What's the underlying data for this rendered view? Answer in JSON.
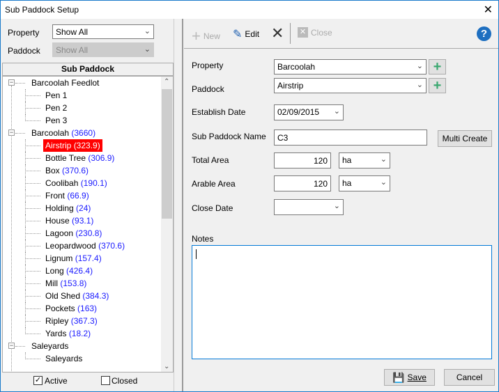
{
  "window": {
    "title": "Sub Paddock Setup",
    "close": "✕"
  },
  "filter": {
    "property_label": "Property",
    "property_value": "Show All",
    "paddock_label": "Paddock",
    "paddock_value": "Show All"
  },
  "tree": {
    "header": "Sub Paddock",
    "rows": [
      {
        "level": 0,
        "label": "Barcoolah Feedlot",
        "count": ""
      },
      {
        "level": 1,
        "label": "Pen 1",
        "count": ""
      },
      {
        "level": 1,
        "label": "Pen 2",
        "count": ""
      },
      {
        "level": 1,
        "label": "Pen 3",
        "count": ""
      },
      {
        "level": 0,
        "label": "Barcoolah",
        "count": "(3660)"
      },
      {
        "level": 1,
        "label": "Airstrip",
        "count": "(323.9)",
        "selected": true
      },
      {
        "level": 1,
        "label": "Bottle Tree",
        "count": "(306.9)"
      },
      {
        "level": 1,
        "label": "Box",
        "count": "(370.6)"
      },
      {
        "level": 1,
        "label": "Coolibah",
        "count": "(190.1)"
      },
      {
        "level": 1,
        "label": "Front",
        "count": "(66.9)"
      },
      {
        "level": 1,
        "label": "Holding",
        "count": "(24)"
      },
      {
        "level": 1,
        "label": "House",
        "count": "(93.1)"
      },
      {
        "level": 1,
        "label": "Lagoon",
        "count": "(230.8)"
      },
      {
        "level": 1,
        "label": "Leopardwood",
        "count": "(370.6)"
      },
      {
        "level": 1,
        "label": "Lignum",
        "count": "(157.4)"
      },
      {
        "level": 1,
        "label": "Long",
        "count": "(426.4)"
      },
      {
        "level": 1,
        "label": "Mill",
        "count": "(153.8)"
      },
      {
        "level": 1,
        "label": "Old Shed",
        "count": "(384.3)"
      },
      {
        "level": 1,
        "label": "Pockets",
        "count": "(163)"
      },
      {
        "level": 1,
        "label": "Ripley",
        "count": "(367.3)"
      },
      {
        "level": 1,
        "label": "Yards",
        "count": "(18.2)"
      },
      {
        "level": 0,
        "label": "Saleyards",
        "count": ""
      },
      {
        "level": 1,
        "label": "Saleyards",
        "count": ""
      }
    ]
  },
  "checks": {
    "active_label": "Active",
    "active_checked": true,
    "closed_label": "Closed",
    "closed_checked": false
  },
  "toolbar": {
    "new": "New",
    "edit": "Edit",
    "close": "Close",
    "help": "?"
  },
  "form": {
    "property_label": "Property",
    "property_value": "Barcoolah",
    "paddock_label": "Paddock",
    "paddock_value": "Airstrip",
    "establish_label": "Establish Date",
    "establish_value": "02/09/2015",
    "name_label": "Sub Paddock Name",
    "name_value": "C3",
    "multi_create": "Multi Create",
    "total_label": "Total Area",
    "total_value": "120",
    "total_unit": "ha",
    "arable_label": "Arable Area",
    "arable_value": "120",
    "arable_unit": "ha",
    "close_label": "Close Date",
    "close_value": "",
    "notes_label": "Notes",
    "notes_value": ""
  },
  "buttons": {
    "save": "Save",
    "cancel": "Cancel"
  },
  "colors": {
    "selection": "#ff0000",
    "count": "#1a1aff",
    "add": "#3aa870",
    "help": "#1e6fc0"
  }
}
